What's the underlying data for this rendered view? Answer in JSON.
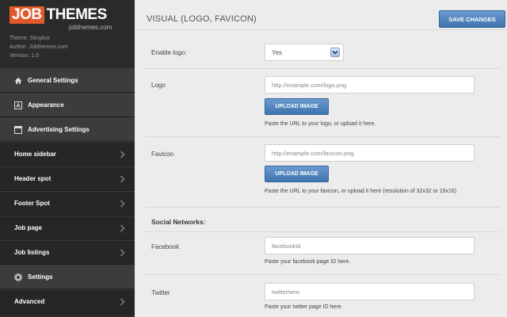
{
  "brand": {
    "logo_job": "JOB",
    "logo_themes": "THEMES",
    "url": "jobthemes.com",
    "theme": "Theme: Simplux",
    "author": "Author: Jobthemes.com",
    "version": "Version: 1.0"
  },
  "sidebar": {
    "items": [
      {
        "label": "General Settings",
        "icon": "home-icon"
      },
      {
        "label": "Appearance",
        "icon": "appearance-icon"
      },
      {
        "label": "Advertising Settings",
        "icon": "window-icon"
      },
      {
        "label": "Home sidebar"
      },
      {
        "label": "Header spot"
      },
      {
        "label": "Footer Spot"
      },
      {
        "label": "Job page"
      },
      {
        "label": "Job listings"
      },
      {
        "label": "Settings",
        "icon": "gear-icon"
      },
      {
        "label": "Advanced"
      }
    ]
  },
  "header": {
    "title": "VISUAL (LOGO, FAVICON)",
    "save_label": "SAVE CHANGES"
  },
  "form": {
    "enable_logo_label": "Enable logo:",
    "enable_logo_value": "Yes",
    "logo_label": "Logo",
    "logo_placeholder": "http://example.com/logo.png",
    "upload_label": "UPLOAD IMAGE",
    "logo_hint": "Paste the URL to your logo, or upload it here.",
    "favicon_label": "Favicon",
    "favicon_placeholder": "http://example.com/favicon.png",
    "favicon_hint": "Paste the URL to your favicon, or upload it here (resolution of 32x32 or 16x16)",
    "social_title": "Social Networks:",
    "facebook_label": "Facebook",
    "facebook_value": "facebookid",
    "facebook_hint": "Paste your facebook page ID here.",
    "twitter_label": "Twitter",
    "twitter_value": "twitterhere",
    "twitter_hint": "Paste your twitter page ID here."
  },
  "colors": {
    "accent_blue": "#3f74ad",
    "logo_orange": "#e25a2b",
    "sidebar_bg": "#2b2b2b"
  }
}
